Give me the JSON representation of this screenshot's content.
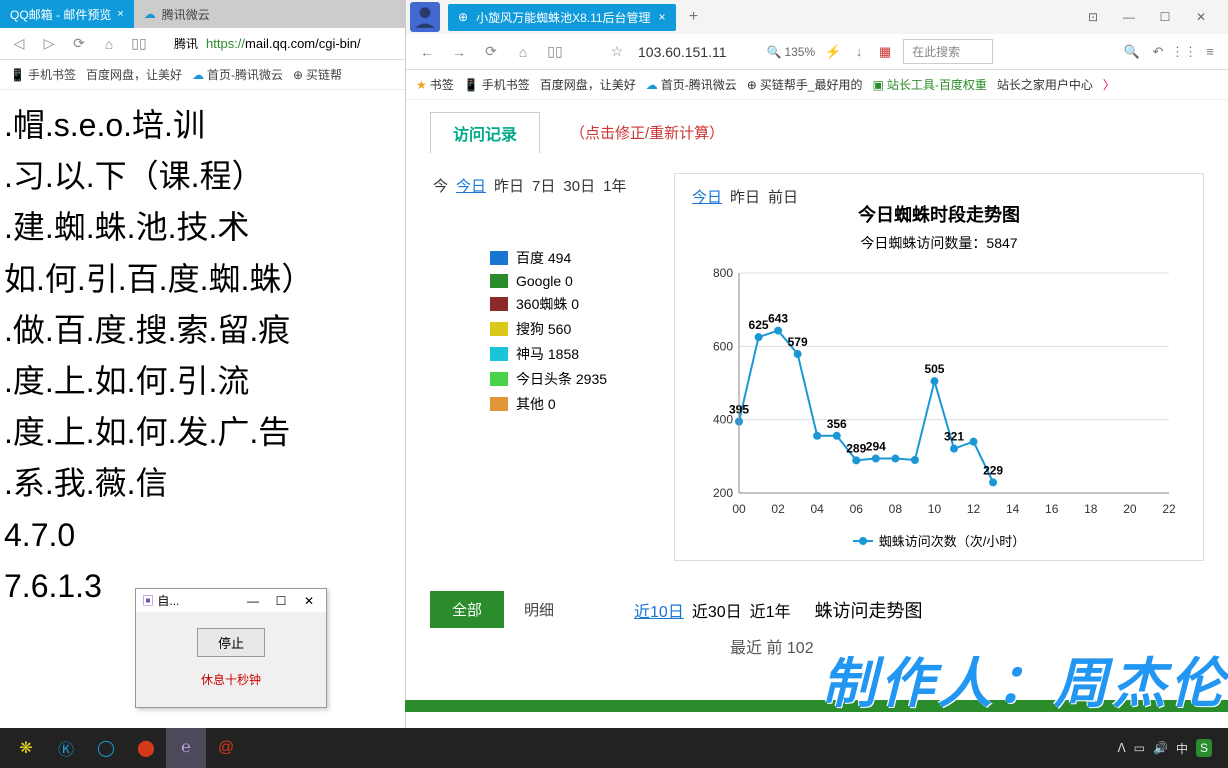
{
  "left_window": {
    "tabs": [
      {
        "label": "QQ邮箱 - 邮件预览",
        "active": true
      },
      {
        "label": "腾讯微云",
        "active": false
      }
    ],
    "address": {
      "label": "腾讯",
      "url_secure": "https://",
      "url_rest": "mail.qq.com/cgi-bin/"
    },
    "bookmarks": [
      "手机书签",
      "百度网盘，让美好",
      "首页-腾讯微云",
      "买链帮"
    ],
    "content": [
      ".帽.s.e.o.培.训",
      ".习.以.下（课.程）",
      ".建.蜘.蛛.池.技.术",
      "如.何.引.百.度.蜘.蛛）",
      ".做.百.度.搜.索.留.痕",
      ".度.上.如.何.引.流",
      ".度.上.如.何.发.广.告",
      ".系.我.薇.信",
      "4.7.0",
      "7.6.1.3"
    ]
  },
  "right_window": {
    "tab": {
      "label": "小旋风万能蜘蛛池X8.11后台管理"
    },
    "address": "103.60.151.11",
    "zoom": "135%",
    "search_placeholder": "在此搜索",
    "bookmarks": [
      {
        "label": "书签",
        "color": "#f0a020"
      },
      {
        "label": "手机书签",
        "color": "#333"
      },
      {
        "label": "百度网盘，让美好",
        "color": "#333"
      },
      {
        "label": "首页-腾讯微云",
        "color": "#333"
      },
      {
        "label": "买链帮手_最好用的",
        "color": "#333"
      },
      {
        "label": "站长工具-百度权重",
        "color": "#2a8c2a"
      },
      {
        "label": "站长之家用户中心",
        "color": "#333"
      }
    ],
    "page_tab": "访问记录",
    "page_link": "（点击修正/重新计算）",
    "date_tabs": [
      "今",
      "今日",
      "昨日",
      "7日",
      "30日",
      "1年"
    ],
    "date_active": 1,
    "legend": [
      {
        "label": "百度 494",
        "color": "#1976d2"
      },
      {
        "label": "Google 0",
        "color": "#2a8c2a"
      },
      {
        "label": "360蜘蛛 0",
        "color": "#8c2a2a"
      },
      {
        "label": "搜狗 560",
        "color": "#dbc91a"
      },
      {
        "label": "神马 1858",
        "color": "#1ac4db"
      },
      {
        "label": "今日头条 2935",
        "color": "#4ad14a"
      },
      {
        "label": "其他 0",
        "color": "#e0973a"
      }
    ],
    "chart_title": "今日蜘蛛时段走势图",
    "chart_subtitle_prefix": "今日蜘蛛访问数量：",
    "chart_subtitle_value": "5847",
    "chart_legend_label": "蜘蛛访问次数（次/小时）",
    "bottom": {
      "all": "全部",
      "detail": "明细",
      "ranges": [
        "近10日",
        "近30日",
        "近1年"
      ],
      "range_active": 0,
      "title": "蛛访问走势图",
      "sub": "最近          前          102"
    }
  },
  "popup": {
    "title": "自...",
    "button": "停止",
    "message": "休息十秒钟"
  },
  "watermark": "制作人：周杰伦",
  "tray": {
    "ime": "中"
  },
  "chart_data": {
    "type": "line",
    "title": "今日蜘蛛时段走势图",
    "xlabel": "",
    "ylabel": "",
    "ylim": [
      200,
      800
    ],
    "xlim": [
      0,
      22
    ],
    "x": [
      0,
      1,
      2,
      3,
      4,
      5,
      6,
      7,
      8,
      9,
      10,
      11,
      12,
      13
    ],
    "values": [
      395,
      625,
      643,
      579,
      356,
      356,
      289,
      294,
      294,
      290,
      505,
      321,
      340,
      229
    ],
    "labels_visible": {
      "0": 395,
      "1": 625,
      "2": 643,
      "3": 579,
      "5": 356,
      "6": 289,
      "7": 294,
      "10": 505,
      "11": 321,
      "13": 229
    },
    "series_name": "蜘蛛访问次数（次/小时）"
  }
}
